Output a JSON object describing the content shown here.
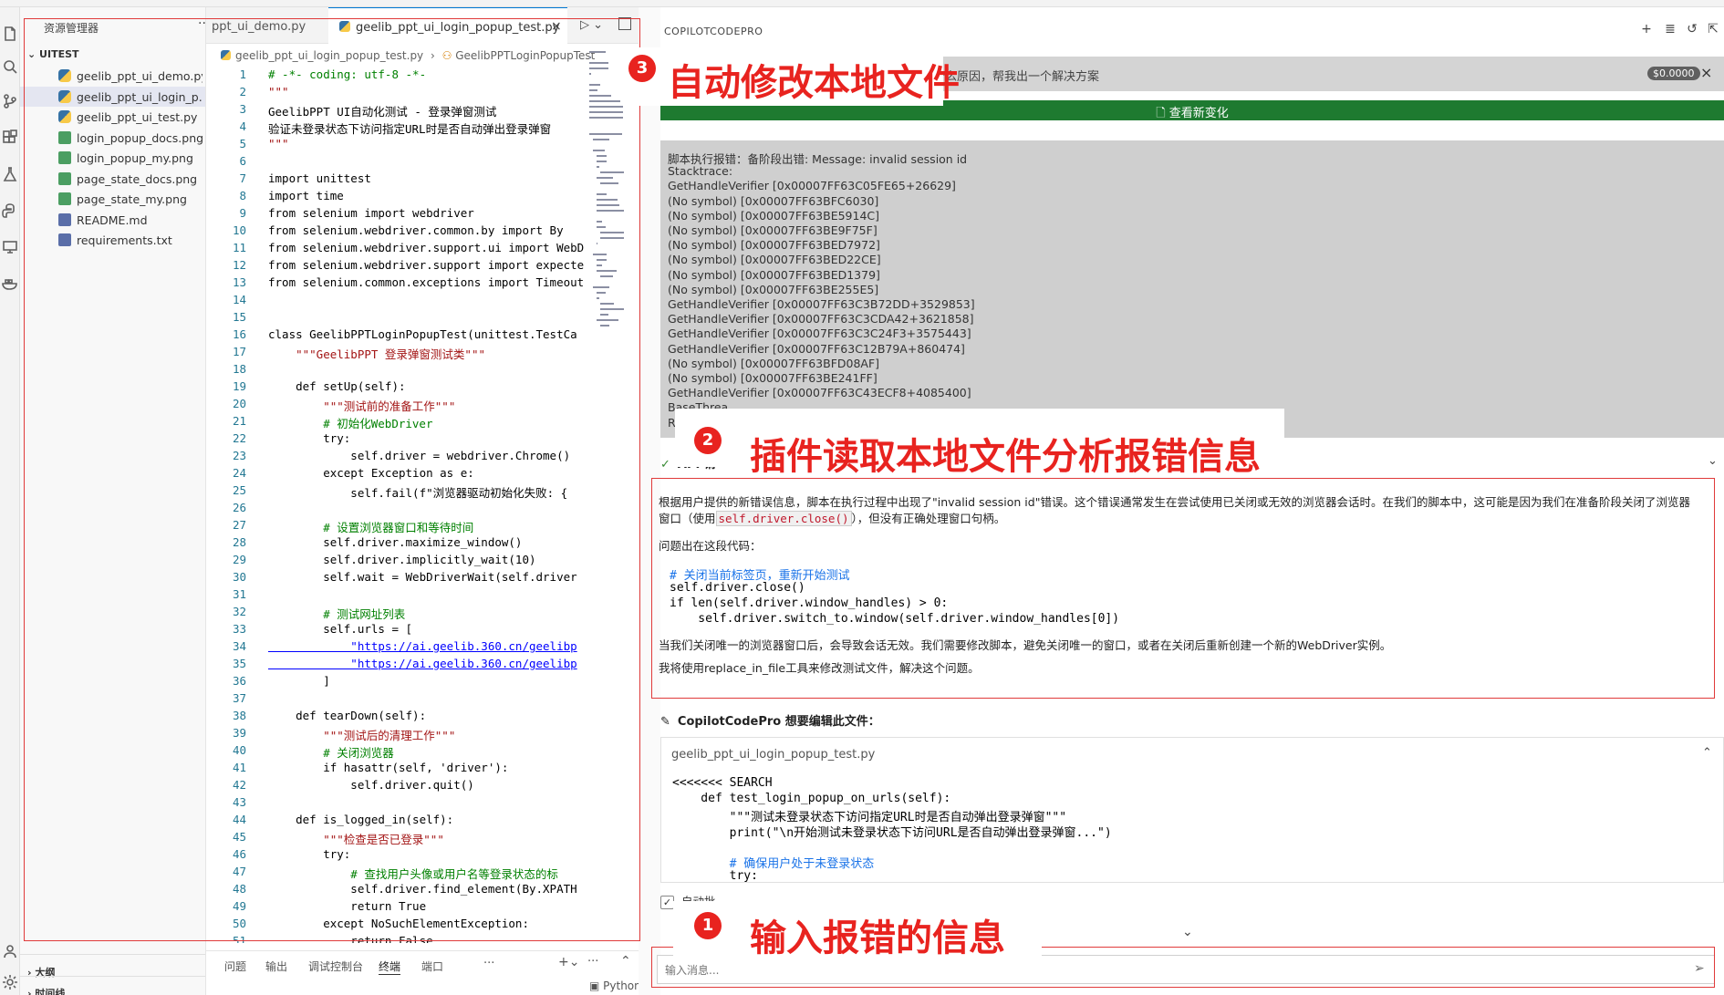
{
  "explorer": {
    "title": "资源管理器",
    "more": "···",
    "folder": "UITEST",
    "files": [
      {
        "name": "geelib_ppt_ui_demo.py",
        "type": "py"
      },
      {
        "name": "geelib_ppt_ui_login_p...",
        "type": "py"
      },
      {
        "name": "geelib_ppt_ui_test.py",
        "type": "py"
      },
      {
        "name": "login_popup_docs.png",
        "type": "png"
      },
      {
        "name": "login_popup_my.png",
        "type": "png"
      },
      {
        "name": "page_state_docs.png",
        "type": "png"
      },
      {
        "name": "page_state_my.png",
        "type": "png"
      },
      {
        "name": "README.md",
        "type": "md"
      },
      {
        "name": "requirements.txt",
        "type": "txt"
      }
    ],
    "outline": "大纲",
    "timeline": "时间线"
  },
  "editor": {
    "tab1": "ppt_ui_demo.py",
    "tab2": "geelib_ppt_ui_login_popup_test.py",
    "tab_close": "×",
    "breadcrumb_file": "geelib_ppt_ui_login_popup_test.py",
    "breadcrumb_sep": "›",
    "breadcrumb_class": "GeelibPPTLoginPopupTest",
    "code": [
      "# -*- coding: utf-8 -*-",
      "\"\"\"",
      "GeelibPPT UI自动化测试 - 登录弹窗测试",
      "验证未登录状态下访问指定URL时是否自动弹出登录弹窗",
      "\"\"\"",
      "",
      "import unittest",
      "import time",
      "from selenium import webdriver",
      "from selenium.webdriver.common.by import By",
      "from selenium.webdriver.support.ui import WebD",
      "from selenium.webdriver.support import expecte",
      "from selenium.common.exceptions import Timeout",
      "",
      "",
      "class GeelibPPTLoginPopupTest(unittest.TestCa",
      "    \"\"\"GeelibPPT 登录弹窗测试类\"\"\"",
      "",
      "    def setUp(self):",
      "        \"\"\"测试前的准备工作\"\"\"",
      "        # 初始化WebDriver",
      "        try:",
      "            self.driver = webdriver.Chrome()",
      "        except Exception as e:",
      "            self.fail(f\"浏览器驱动初始化失败: {",
      "",
      "        # 设置浏览器窗口和等待时间",
      "        self.driver.maximize_window()",
      "        self.driver.implicitly_wait(10)",
      "        self.wait = WebDriverWait(self.driver",
      "",
      "        # 测试网址列表",
      "        self.urls = [",
      "            \"https://ai.geelib.360.cn/geelibp",
      "            \"https://ai.geelib.360.cn/geelibp",
      "        ]",
      "",
      "    def tearDown(self):",
      "        \"\"\"测试后的清理工作\"\"\"",
      "        # 关闭浏览器",
      "        if hasattr(self, 'driver'):",
      "            self.driver.quit()",
      "",
      "    def is_logged_in(self):",
      "        \"\"\"检查是否已登录\"\"\"",
      "        try:",
      "            # 查找用户头像或用户名等登录状态的标",
      "            self.driver.find_element(By.XPATH",
      "            return True",
      "        except NoSuchElementException:",
      "            return False"
    ]
  },
  "panel": {
    "tabs": [
      "问题",
      "输出",
      "调试控制台",
      "终端",
      "端口"
    ],
    "more": "···",
    "python_label": "Python"
  },
  "chat": {
    "title": "COPILOTCODEPRO",
    "top_query": "是什么原因，帮我出一个解决方案",
    "cost": "$0.0000",
    "view_changes": "查看新变化",
    "error_lines": [
      "脚本执行报错：备阶段出错: Message: invalid session id",
      "Stacktrace:",
      "GetHandleVerifier [0x00007FF63C05FE65+26629]",
      "(No symbol) [0x00007FF63BFC6030]",
      "(No symbol) [0x00007FF63BE5914C]",
      "(No symbol) [0x00007FF63BE9F75F]",
      "(No symbol) [0x00007FF63BED7972]",
      "(No symbol) [0x00007FF63BED22CE]",
      "(No symbol) [0x00007FF63BED1379]",
      "(No symbol) [0x00007FF63BE255E5]",
      "GetHandleVerifier [0x00007FF63C3B72DD+3529853]",
      "GetHandleVerifier [0x00007FF63C3CDA42+3621858]",
      "GetHandleVerifier [0x00007FF63C3C24F3+3575443]",
      "GetHandleVerifier [0x00007FF63C12B79A+860474]",
      "(No symbol) [0x00007FF63BFD08AF]",
      "(No symbol) [0x00007FF63BE241FF]",
      "GetHandleVerifier [0x00007FF63C43ECF8+4085400]",
      "BaseThrea",
      "RtlUserThr"
    ],
    "api_label": "API 请",
    "response": {
      "p1a": "根据用户提供的新错误信息，脚本在执行过程中出现了\"invalid session id\"错误。这个错误通常发生在尝试使用已关闭或无效的浏览器会话时。在我们的脚本中，这可能是因为我们在准备阶段关闭了浏览器",
      "p1b_pre": "窗口（使用",
      "p1b_code": "self.driver.close()",
      "p1b_post": "），但没有正确处理窗口句柄。",
      "p2": "问题出在这段代码：",
      "code": [
        "# 关闭当前标签页，重新开始测试",
        "self.driver.close()",
        "if len(self.driver.window_handles) > 0:",
        "    self.driver.switch_to.window(self.driver.window_handles[0])"
      ],
      "p3": "当我们关闭唯一的浏览器窗口后，会导致会话无效。我们需要修改脚本，避免关闭唯一的窗口，或者在关闭后重新创建一个新的WebDriver实例。",
      "p4": "我将使用replace_in_file工具来修改测试文件，解决这个问题。"
    },
    "edit_label": "CopilotCodePro 想要编辑此文件：",
    "diff_file": "geelib_ppt_ui_login_popup_test.py",
    "diff_lines": [
      "<<<<<<< SEARCH",
      "    def test_login_popup_on_urls(self):",
      "        \"\"\"测试未登录状态下访问指定URL时是否自动弹出登录弹窗\"\"\"",
      "        print(\"\\n开始测试未登录状态下访问URL是否自动弹出登录弹窗...\")",
      "",
      "        # 确保用户处于未登录状态",
      "        try:"
    ],
    "auto_label": "自动批",
    "input_placeholder": "输入消息..."
  },
  "annotations": {
    "a1_num": "1",
    "a1_text": "输入报错的信息",
    "a2_num": "2",
    "a2_text": "插件读取本地文件分析报错信息",
    "a3_num": "3",
    "a3_text": "自动修改本地文件"
  }
}
